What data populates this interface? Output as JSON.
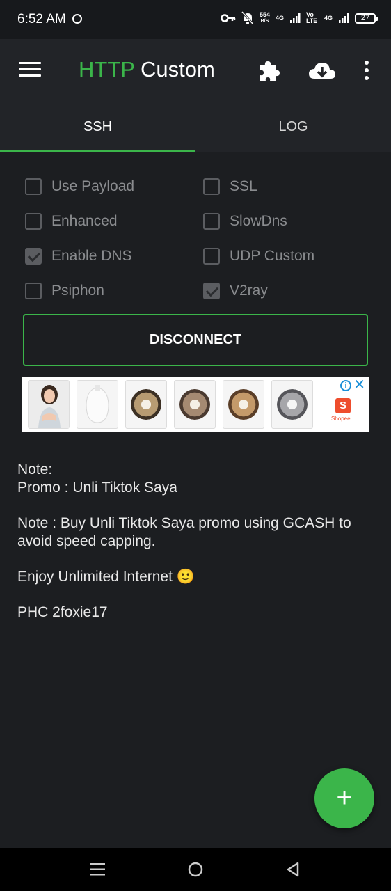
{
  "status_bar": {
    "time": "6:52 AM",
    "net_speed_value": "554",
    "net_speed_unit": "B/S",
    "network_1": "4G",
    "volte": "Vo LTE",
    "network_2": "4G",
    "battery": "27"
  },
  "toolbar": {
    "title_part1": "HTTP",
    "title_part2": "Custom"
  },
  "tabs": [
    {
      "label": "SSH",
      "active": true
    },
    {
      "label": "LOG",
      "active": false
    }
  ],
  "options": {
    "left": [
      {
        "label": "Use Payload",
        "checked": false
      },
      {
        "label": "Enhanced",
        "checked": false
      },
      {
        "label": "Enable DNS",
        "checked": true
      },
      {
        "label": "Psiphon",
        "checked": false
      }
    ],
    "right": [
      {
        "label": "SSL",
        "checked": false
      },
      {
        "label": "SlowDns",
        "checked": false
      },
      {
        "label": "UDP Custom",
        "checked": false
      },
      {
        "label": "V2ray",
        "checked": true
      }
    ]
  },
  "disconnect_label": "DISCONNECT",
  "ad": {
    "brand": "Shopee"
  },
  "notes": {
    "line1": "Note:",
    "line2": "Promo : Unli Tiktok Saya",
    "line3a": "Note : Buy Unli Tiktok Saya promo using GCASH to",
    "line3b": "avoid speed capping.",
    "line4": "Enjoy Unlimited Internet 🙂",
    "line5": "PHC 2foxie17"
  },
  "fab_label": "+",
  "colors": {
    "accent": "#3bb54a",
    "background": "#1c1e21",
    "toolbar": "#222428"
  }
}
